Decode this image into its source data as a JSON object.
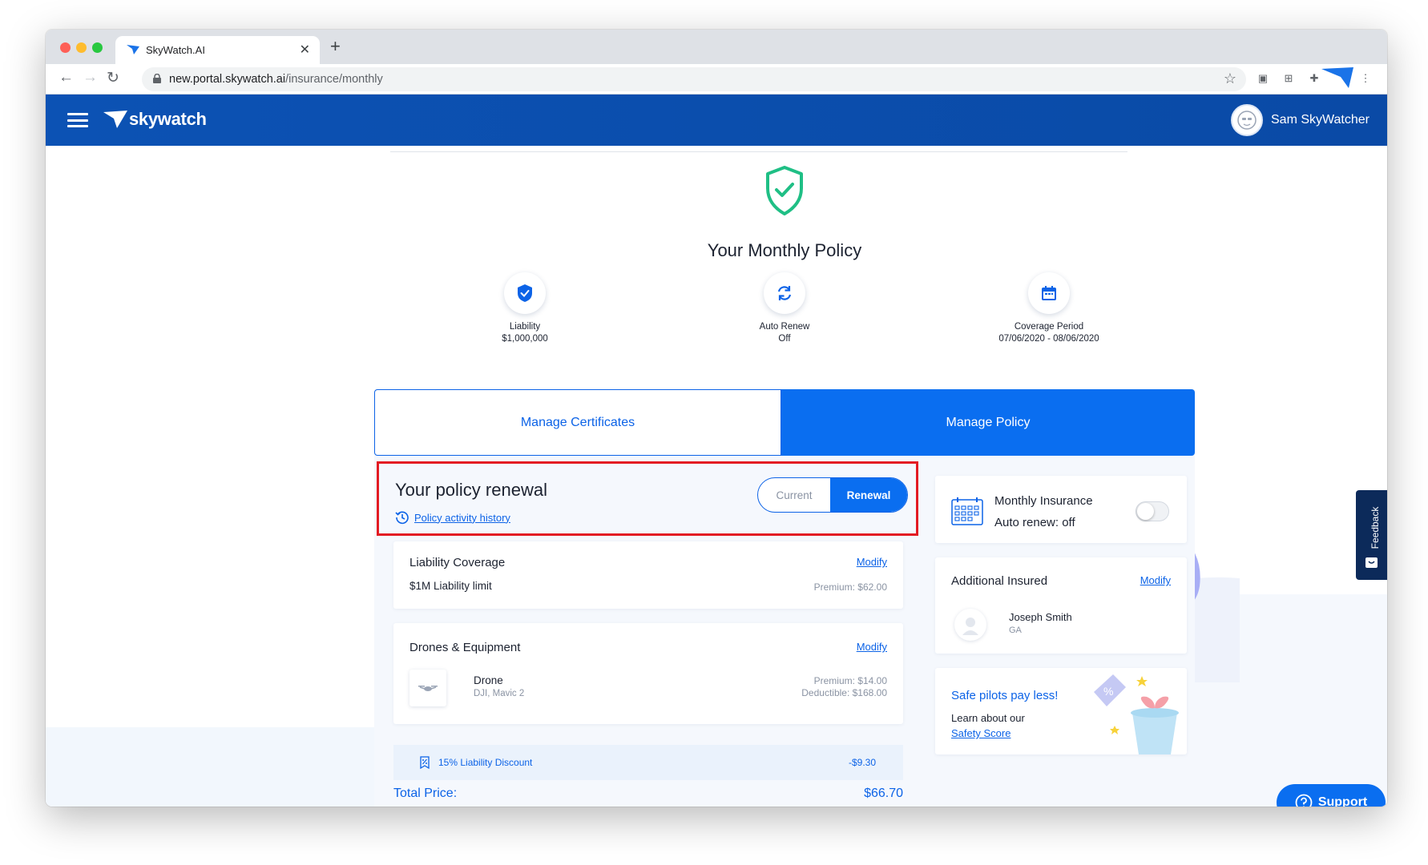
{
  "browser": {
    "tab_title": "SkyWatch.AI",
    "url_host": "new.portal.skywatch.ai",
    "url_path": "/insurance/monthly"
  },
  "header": {
    "logo_text": "skywatch",
    "user_name": "Sam SkyWatcher"
  },
  "policy": {
    "title": "Your Monthly Policy",
    "stats": [
      {
        "label": "Liability",
        "value": "$1,000,000",
        "icon": "shield-check-icon"
      },
      {
        "label": "Auto Renew",
        "value": "Off",
        "icon": "sync-icon"
      },
      {
        "label": "Coverage Period",
        "value": "07/06/2020 - 08/06/2020",
        "icon": "calendar-icon"
      }
    ]
  },
  "actions": {
    "manage_certificates": "Manage Certificates",
    "manage_policy": "Manage Policy"
  },
  "renewal": {
    "title": "Your policy renewal",
    "history_link": "Policy activity history",
    "toggle_current": "Current",
    "toggle_renewal": "Renewal"
  },
  "liability": {
    "title": "Liability Coverage",
    "modify": "Modify",
    "limit": "$1M Liability limit",
    "premium": "Premium: $62.00"
  },
  "drones": {
    "title": "Drones & Equipment",
    "modify": "Modify",
    "item_name": "Drone",
    "item_model": "DJI, Mavic 2",
    "premium": "Premium: $14.00",
    "deductible": "Deductible: $168.00"
  },
  "discount": {
    "label": "15% Liability Discount",
    "value": "-$9.30"
  },
  "total": {
    "label": "Total Price:",
    "value": "$66.70"
  },
  "monthly": {
    "title": "Monthly Insurance",
    "subtitle": "Auto renew: off",
    "toggle_on": false
  },
  "additional": {
    "title": "Additional Insured",
    "modify": "Modify",
    "name": "Joseph Smith",
    "state": "GA"
  },
  "safety": {
    "title": "Safe pilots pay less!",
    "text": "Learn about our",
    "link": "Safety Score"
  },
  "feedback": "Feedback",
  "support": "Support",
  "colors": {
    "brand_blue": "#0a6ef0",
    "header_blue": "#0c52b4",
    "shield_green": "#1fbf85",
    "highlight_red": "#e31b23"
  }
}
